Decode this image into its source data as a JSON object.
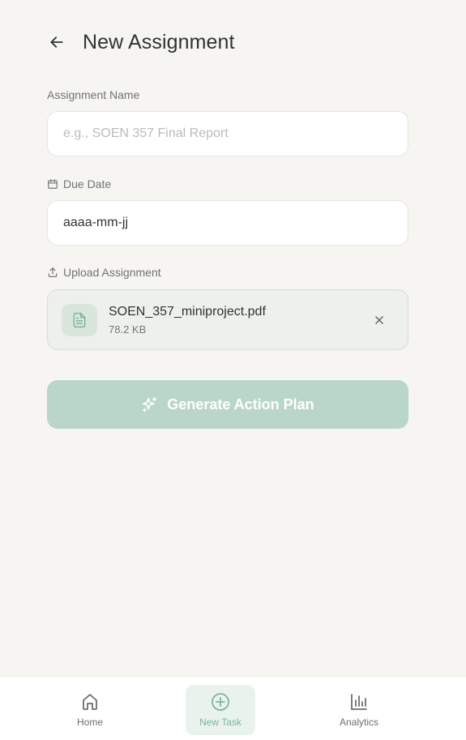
{
  "header": {
    "title": "New Assignment",
    "back_icon": "arrow-left-icon"
  },
  "form": {
    "name_label": "Assignment Name",
    "name_placeholder": "e.g., SOEN 357 Final Report",
    "name_value": "",
    "due_label": "Due Date",
    "due_icon": "calendar-icon",
    "due_value": "aaaa-mm-jj",
    "upload_label": "Upload Assignment",
    "upload_icon": "upload-icon"
  },
  "file": {
    "icon": "file-text-icon",
    "name": "SOEN_357_miniproject.pdf",
    "size": "78.2 KB",
    "remove_icon": "close-icon"
  },
  "action": {
    "generate_label": "Generate Action Plan",
    "generate_icon": "sparkles-icon"
  },
  "nav": {
    "items": [
      {
        "label": "Home",
        "icon": "home-icon",
        "active": false
      },
      {
        "label": "New Task",
        "icon": "plus-circle-icon",
        "active": true
      },
      {
        "label": "Analytics",
        "icon": "bar-chart-icon",
        "active": false
      }
    ]
  },
  "colors": {
    "background": "#f6f5f1",
    "accent": "#7cb698",
    "button_disabled": "#bad6c9",
    "file_card": "#edf0eb"
  }
}
